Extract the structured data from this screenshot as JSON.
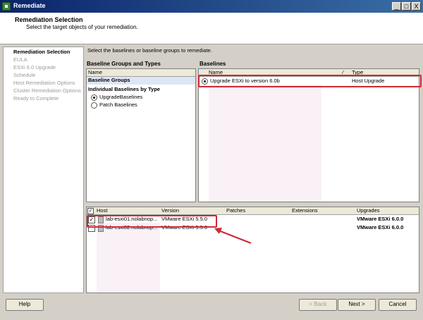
{
  "window": {
    "title": "Remediate",
    "minimize": "_",
    "maximize": "□",
    "close": "X"
  },
  "header": {
    "title": "Remediation Selection",
    "subtitle": "Select the target objects of your remediation."
  },
  "steps": [
    {
      "label": "Remediation Selection",
      "active": true
    },
    {
      "label": "EULA"
    },
    {
      "label": "ESXi 6.0 Upgrade"
    },
    {
      "label": "Schedule"
    },
    {
      "label": "Host Remediation Options"
    },
    {
      "label": "Cluster Remediation Options"
    },
    {
      "label": "Ready to Complete"
    }
  ],
  "instruction": "Select the baselines or baseline groups to remediate.",
  "baseline_groups": {
    "title": "Baseline Groups and Types",
    "column": "Name",
    "selected_row": "Baseline Groups",
    "section_label": "Individual Baselines by Type",
    "options": [
      "UpgradeBaselines",
      "Patch Baselines"
    ],
    "selected_option": "UpgradeBaselines"
  },
  "baselines": {
    "title": "Baselines",
    "columns": [
      "Name",
      "Type"
    ],
    "rows": [
      {
        "name": "Upgrade ESXi to version 6.0b",
        "type": "Host Upgrade",
        "selected": true
      }
    ]
  },
  "hosts": {
    "columns": [
      "Host",
      "Version",
      "Patches",
      "Extensions",
      "Upgrades"
    ],
    "rows": [
      {
        "host": "lab-esxi01.nolabnop...",
        "version": "VMware ESXi 5.5.0",
        "patches": "",
        "extensions": "",
        "upgrades": "VMware ESXi 6.0.0",
        "checked": true
      },
      {
        "host": "lab-esxi02.nolabnop...",
        "version": "VMware ESXi 5.5.0",
        "patches": "",
        "extensions": "",
        "upgrades": "VMware ESXi 6.0.0",
        "checked": false
      }
    ]
  },
  "buttons": {
    "help": "Help",
    "back": "< Back",
    "next": "Next >",
    "cancel": "Cancel"
  },
  "colors": {
    "annotation_red": "#cc2a36",
    "titlebar": "#0a246a"
  }
}
